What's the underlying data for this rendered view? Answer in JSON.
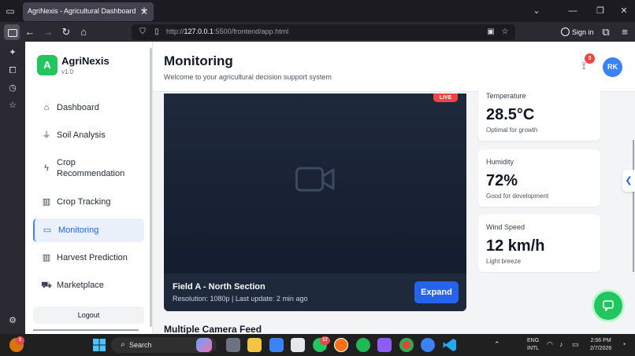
{
  "browser": {
    "tab_title": "AgriNexis - Agricultural Dashboard",
    "url_prefix": "http://",
    "url_host": "127.0.0.1",
    "url_path": ":5500/frontend/app.html",
    "sign_in": "Sign in"
  },
  "app": {
    "brand": {
      "logo_letter": "A",
      "name": "AgriNexis",
      "version": "v1.0"
    },
    "nav": [
      {
        "label": "Dashboard",
        "icon": "dashboard-icon"
      },
      {
        "label": "Soil Analysis",
        "icon": "soil-icon"
      },
      {
        "label": "Crop Recommendation",
        "icon": "lightning-icon"
      },
      {
        "label": "Crop Tracking",
        "icon": "bar-chart-icon"
      },
      {
        "label": "Monitoring",
        "icon": "video-camera-icon",
        "active": true
      },
      {
        "label": "Harvest Prediction",
        "icon": "bar-chart-icon"
      },
      {
        "label": "Marketplace",
        "icon": "cart-icon"
      }
    ],
    "logout": "Logout",
    "header": {
      "title": "Monitoring",
      "subtitle": "Welcome to your agricultural decision support system",
      "notification_count": "3",
      "user_initials": "RK"
    },
    "camera": {
      "live": "LIVE",
      "name": "Field A - North Section",
      "meta": "Resolution: 1080p | Last update: 2 min ago",
      "expand": "Expand"
    },
    "section_title": "Multiple Camera Feed",
    "stats": [
      {
        "label": "Temperature",
        "value": "28.5°C",
        "note": "Optimal for growth"
      },
      {
        "label": "Humidity",
        "value": "72%",
        "note": "Good for development"
      },
      {
        "label": "Wind Speed",
        "value": "12 km/h",
        "note": "Light breeze"
      }
    ]
  },
  "taskbar": {
    "search": "Search",
    "badge_left": "1",
    "badge_whatsapp": "17",
    "lang_top": "ENG",
    "lang_bottom": "INTL",
    "time": "2:56 PM",
    "date": "2/7/2026"
  },
  "colors": {
    "brand_green": "#22c55e",
    "accent_blue": "#2563eb",
    "live_red": "#ef4444"
  }
}
